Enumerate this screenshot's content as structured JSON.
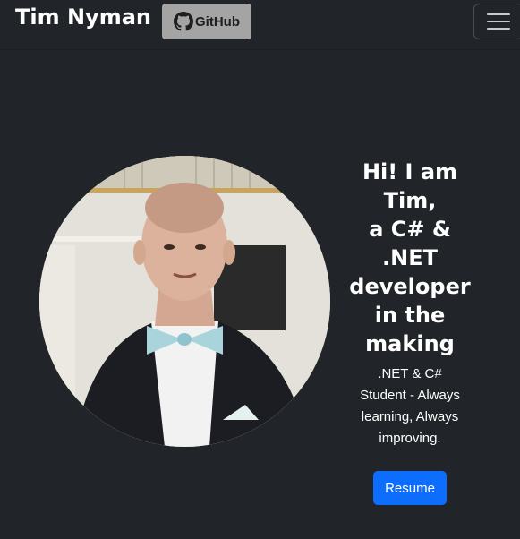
{
  "navbar": {
    "brand": "Tim Nyman",
    "github_label": "GitHub",
    "github_icon": "github-icon",
    "menu_icon": "hamburger-menu-icon"
  },
  "hero": {
    "title_lines": [
      "Hi! I am",
      "Tim,",
      "a C# &",
      ".NET",
      "developer",
      "in the",
      "making"
    ],
    "subtitle_lines": [
      ".NET & C#",
      "Student - Always",
      "learning, Always",
      "improving."
    ],
    "resume_label": "Resume"
  },
  "colors": {
    "background": "#212529",
    "github_button": "#a4a4a4",
    "resume_button": "#0d6efd"
  }
}
